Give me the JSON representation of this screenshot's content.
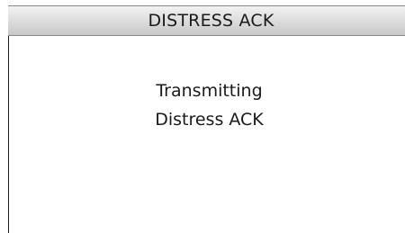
{
  "header": {
    "title": "DISTRESS ACK"
  },
  "main": {
    "message_line_1": "Transmitting",
    "message_line_2": "Distress ACK"
  }
}
